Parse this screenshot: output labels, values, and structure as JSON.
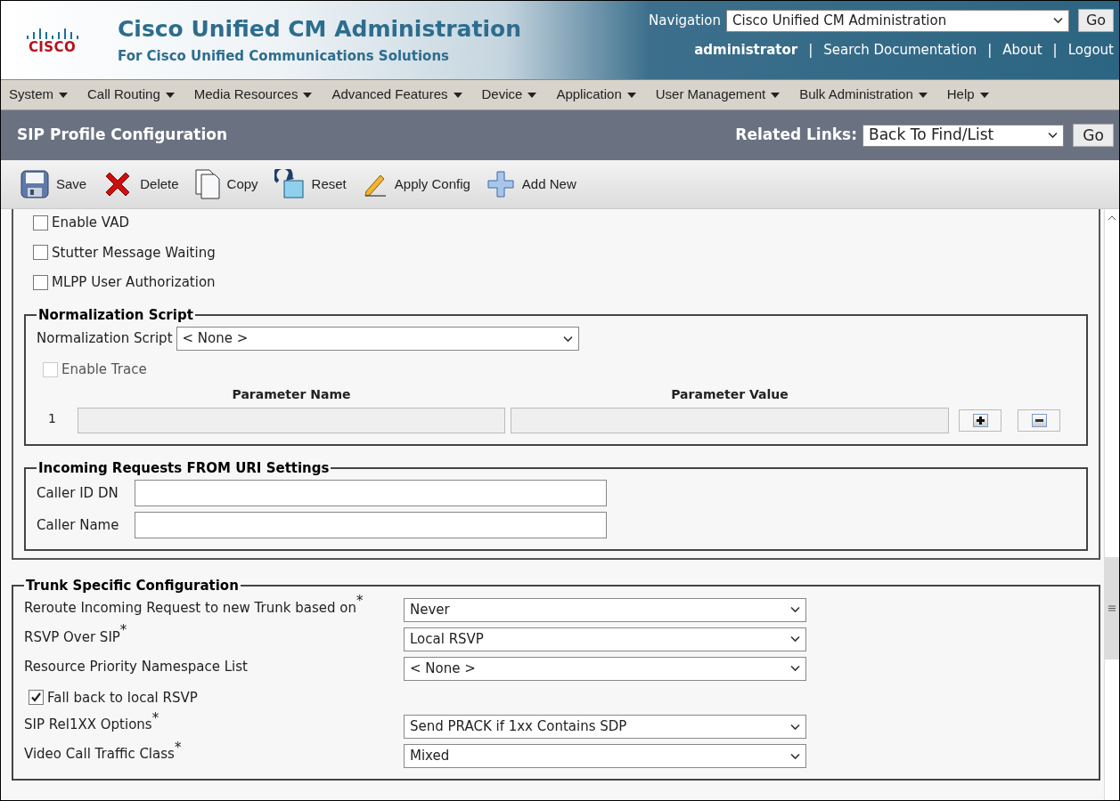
{
  "header": {
    "title": "Cisco Unified CM Administration",
    "subtitle": "For Cisco Unified Communications Solutions",
    "logo_text": "CISCO",
    "navigation_label": "Navigation",
    "navigation_value": "Cisco Unified CM Administration",
    "go": "Go",
    "user": "administrator",
    "links": [
      "Search Documentation",
      "About",
      "Logout"
    ],
    "separator": "|"
  },
  "menu": [
    "System",
    "Call Routing",
    "Media Resources",
    "Advanced Features",
    "Device",
    "Application",
    "User Management",
    "Bulk Administration",
    "Help"
  ],
  "title_bar": {
    "title": "SIP Profile Configuration",
    "related_label": "Related Links:",
    "related_value": "Back To Find/List",
    "go": "Go"
  },
  "toolbar": [
    {
      "kind": "save",
      "label": "Save"
    },
    {
      "kind": "delete",
      "label": "Delete"
    },
    {
      "kind": "copy",
      "label": "Copy"
    },
    {
      "kind": "reset",
      "label": "Reset"
    },
    {
      "kind": "apply",
      "label": "Apply Config"
    },
    {
      "kind": "add",
      "label": "Add New"
    }
  ],
  "checkboxes": [
    {
      "label": "Enable VAD",
      "checked": false
    },
    {
      "label": "Stutter Message Waiting",
      "checked": false
    },
    {
      "label": "MLPP User Authorization",
      "checked": false
    }
  ],
  "normalization": {
    "legend": "Normalization Script",
    "script_label": "Normalization Script",
    "script_value": "< None >",
    "enable_trace": {
      "label": "Enable Trace",
      "checked": false,
      "disabled": true
    },
    "columns": [
      "Parameter Name",
      "Parameter Value"
    ],
    "rows": [
      {
        "index": "1"
      }
    ]
  },
  "incoming": {
    "legend": "Incoming Requests FROM URI Settings",
    "fields": [
      {
        "label": "Caller ID DN"
      },
      {
        "label": "Caller Name"
      }
    ]
  },
  "trunk": {
    "legend": "Trunk Specific Configuration",
    "required_mark": "*",
    "rows": [
      {
        "kind": "select",
        "label": "Reroute Incoming Request to new Trunk based on",
        "required": true,
        "value": "Never"
      },
      {
        "kind": "select",
        "label": "RSVP Over SIP",
        "required": true,
        "value": "Local RSVP"
      },
      {
        "kind": "select",
        "label": "Resource Priority Namespace List",
        "required": false,
        "value": "< None >"
      },
      {
        "kind": "checkbox",
        "label": "Fall back to local RSVP",
        "checked": true
      },
      {
        "kind": "select",
        "label": "SIP Rel1XX Options",
        "required": true,
        "value": "Send PRACK if 1xx Contains SDP"
      },
      {
        "kind": "select",
        "label": "Video Call Traffic Class",
        "required": true,
        "value": "Mixed"
      }
    ]
  }
}
